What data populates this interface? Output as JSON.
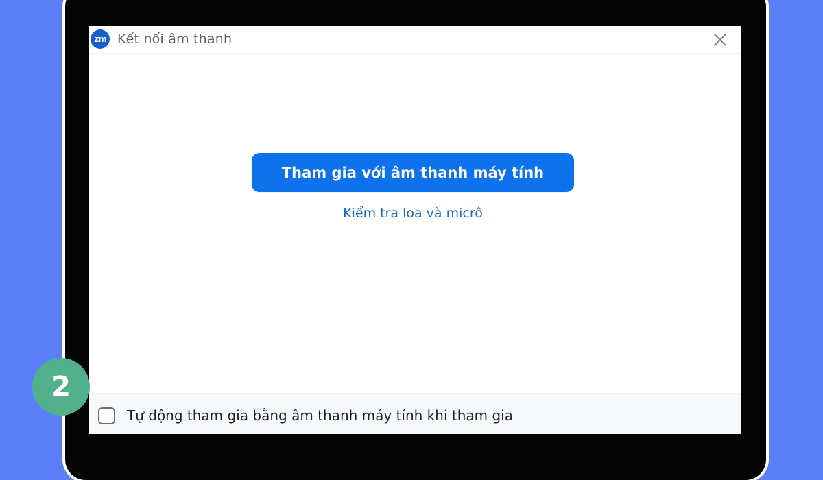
{
  "window": {
    "title": "Kết nối âm thanh",
    "logo_text": "zm",
    "close_icon": "close-icon"
  },
  "main": {
    "join_button_label": "Tham gia với âm thanh máy tính",
    "test_link_label": "Kiểm tra loa và micrô"
  },
  "footer": {
    "auto_join_checked": false,
    "auto_join_label": "Tự động tham gia bằng âm thanh máy tính khi tham gia"
  },
  "step_badge": "2",
  "colors": {
    "background": "#5b7ff6",
    "primary_button": "#0e72ed",
    "link": "#1c6ac4",
    "step_badge": "#52b18c",
    "app_logo": "#1a5fd0"
  }
}
